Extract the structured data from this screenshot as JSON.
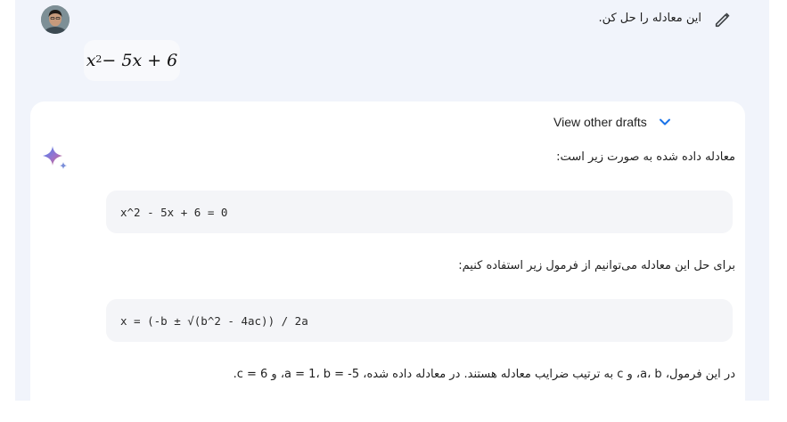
{
  "user": {
    "prompt_text": "این معادله را حل کن.",
    "math": {
      "base": "x",
      "exp": "2",
      "rest": " − 5x + 6"
    }
  },
  "response": {
    "view_other_drafts": "View other drafts",
    "intro": "معادله داده شده به صورت زیر است:",
    "equation_code": "x^2 - 5x + 6 = 0",
    "formula_intro": "برای حل این معادله می‌توانیم از فرمول زیر استفاده کنیم:",
    "formula_code": "x = (-b ± √(b^2 - 4ac)) / 2a",
    "coefficients_text": "در این فرمول، a، b، و c به ترتیب ضرایب معادله هستند. در معادله داده شده، a = 1، b = -5، و c = 6."
  },
  "icons": {
    "edit": "pencil-icon",
    "drafts_toggle": "chevron-down-icon",
    "assistant": "sparkle-icon"
  },
  "colors": {
    "panel_bg": "#f1f4fb",
    "card_bg": "#ffffff",
    "code_bg": "#f4f5f8",
    "chevron": "#1a73e8"
  }
}
